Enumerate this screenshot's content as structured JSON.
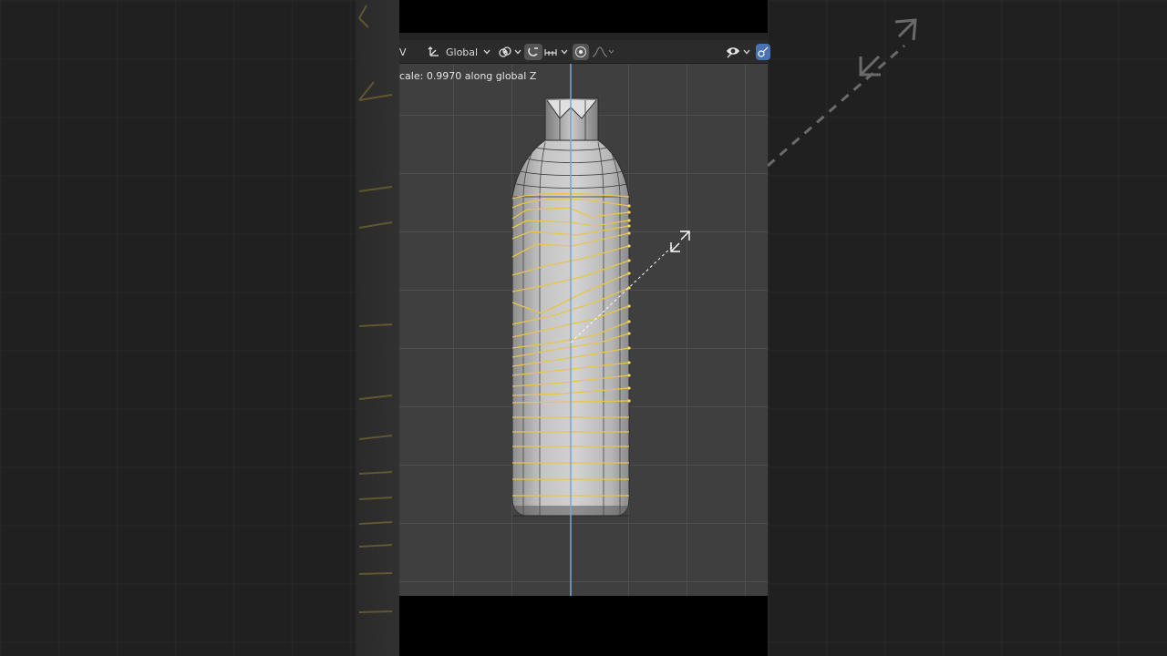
{
  "header": {
    "mode_label": "V",
    "transform_orientation": "Global",
    "icons": {
      "orientation": "axis-orientation-icon",
      "pivot": "pivot-point-icon",
      "snap": "snap-magnet-icon",
      "snap_target": "snap-increment-icon",
      "proportional": "proportional-editing-icon",
      "falloff": "falloff-curve-icon",
      "visibility": "eye-visibility-icon",
      "overlay": "overlay-toggle-icon"
    }
  },
  "viewport": {
    "status_text": "cale: 0.9970 along global Z"
  },
  "colors": {
    "viewport_bg": "#3f3f3f",
    "header_bg": "#2b2b2b",
    "selected_edge": "#e8c547",
    "z_axis": "#6fa8dc",
    "mesh": "#c9c9c9",
    "accent_blue": "#4772b3"
  }
}
